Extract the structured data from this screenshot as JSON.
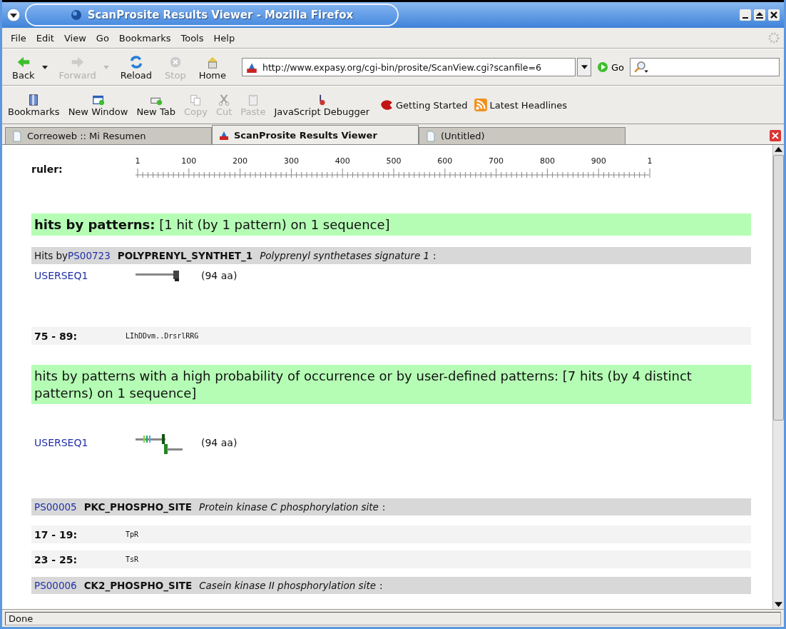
{
  "window": {
    "title": "ScanProsite Results Viewer - Mozilla Firefox"
  },
  "menu": [
    "File",
    "Edit",
    "View",
    "Go",
    "Bookmarks",
    "Tools",
    "Help"
  ],
  "nav_buttons": [
    {
      "label": "Back",
      "kind": "back",
      "disabled": false,
      "dropdown": true
    },
    {
      "label": "Forward",
      "kind": "forward",
      "disabled": true,
      "dropdown": true
    },
    {
      "label": "Reload",
      "kind": "reload",
      "disabled": false,
      "dropdown": false
    },
    {
      "label": "Stop",
      "kind": "stop",
      "disabled": true,
      "dropdown": false
    },
    {
      "label": "Home",
      "kind": "home",
      "disabled": false,
      "dropdown": false
    }
  ],
  "address": {
    "value": "http://www.expasy.org/cgi-bin/prosite/ScanView.cgi?scanfile=6"
  },
  "go_button": "Go",
  "toolbar_buttons": [
    {
      "label": "Bookmarks",
      "kind": "bookmarks",
      "disabled": false
    },
    {
      "label": "New Window",
      "kind": "window",
      "disabled": false
    },
    {
      "label": "New Tab",
      "kind": "tab",
      "disabled": false
    },
    {
      "label": "Copy",
      "kind": "copy",
      "disabled": true
    },
    {
      "label": "Cut",
      "kind": "cut",
      "disabled": true
    },
    {
      "label": "Paste",
      "kind": "paste",
      "disabled": true
    },
    {
      "label": "JavaScript Debugger",
      "kind": "debugger",
      "disabled": false
    }
  ],
  "bookmark_links": [
    {
      "label": "Getting Started",
      "kind": "start"
    },
    {
      "label": "Latest Headlines",
      "kind": "feed"
    }
  ],
  "tabs": [
    {
      "label": "Correoweb :: Mi Resumen",
      "selected": false,
      "kind": "page"
    },
    {
      "label": "ScanProsite Results Viewer",
      "selected": true,
      "kind": "site"
    },
    {
      "label": "(Untitled)",
      "selected": false,
      "kind": "page"
    }
  ],
  "ruler": {
    "label": "ruler:",
    "ticks": [
      "1",
      "100",
      "200",
      "300",
      "400",
      "500",
      "600",
      "700",
      "800",
      "900",
      "1"
    ]
  },
  "blocks": [
    {
      "kind": "summary",
      "text": "**hits by patterns:** [1 hit (by 1 pattern) on 1 sequence]"
    },
    {
      "kind": "pattern",
      "prefix": "Hits by ",
      "accession": "PS00723",
      "name": "POLYPRENYL_SYNTHET_1",
      "description": "Polyprenyl synthetases signature 1",
      "suffix": ":"
    },
    {
      "kind": "sequence",
      "name": "USERSEQ1",
      "length": "(94 aa)"
    },
    {
      "kind": "match",
      "range": "75 - 89:",
      "sequence": "LIhDDvm..DrsrlRRG"
    },
    {
      "kind": "summary",
      "text": "hits by patterns with a high probability of occurrence or by user-defined patterns: [7 hits (by 4 distinct patterns) on 1 sequence]"
    },
    {
      "kind": "multisequence",
      "name": "USERSEQ1",
      "length": "(94 aa)"
    },
    {
      "kind": "pattern",
      "accession": "PS00005",
      "name": "PKC_PHOSPHO_SITE",
      "description": "Protein kinase C phosphorylation site",
      "suffix": ":"
    },
    {
      "kind": "match",
      "range": "17 - 19:",
      "sequence": "TpR"
    },
    {
      "kind": "match",
      "range": "23 - 25:",
      "sequence": "TsR"
    },
    {
      "kind": "pattern",
      "accession": "PS00006",
      "name": "CK2_PHOSPHO_SITE",
      "description": "Casein kinase II phosphorylation site",
      "suffix": ":"
    }
  ],
  "status_bar": {
    "text": "Done"
  }
}
